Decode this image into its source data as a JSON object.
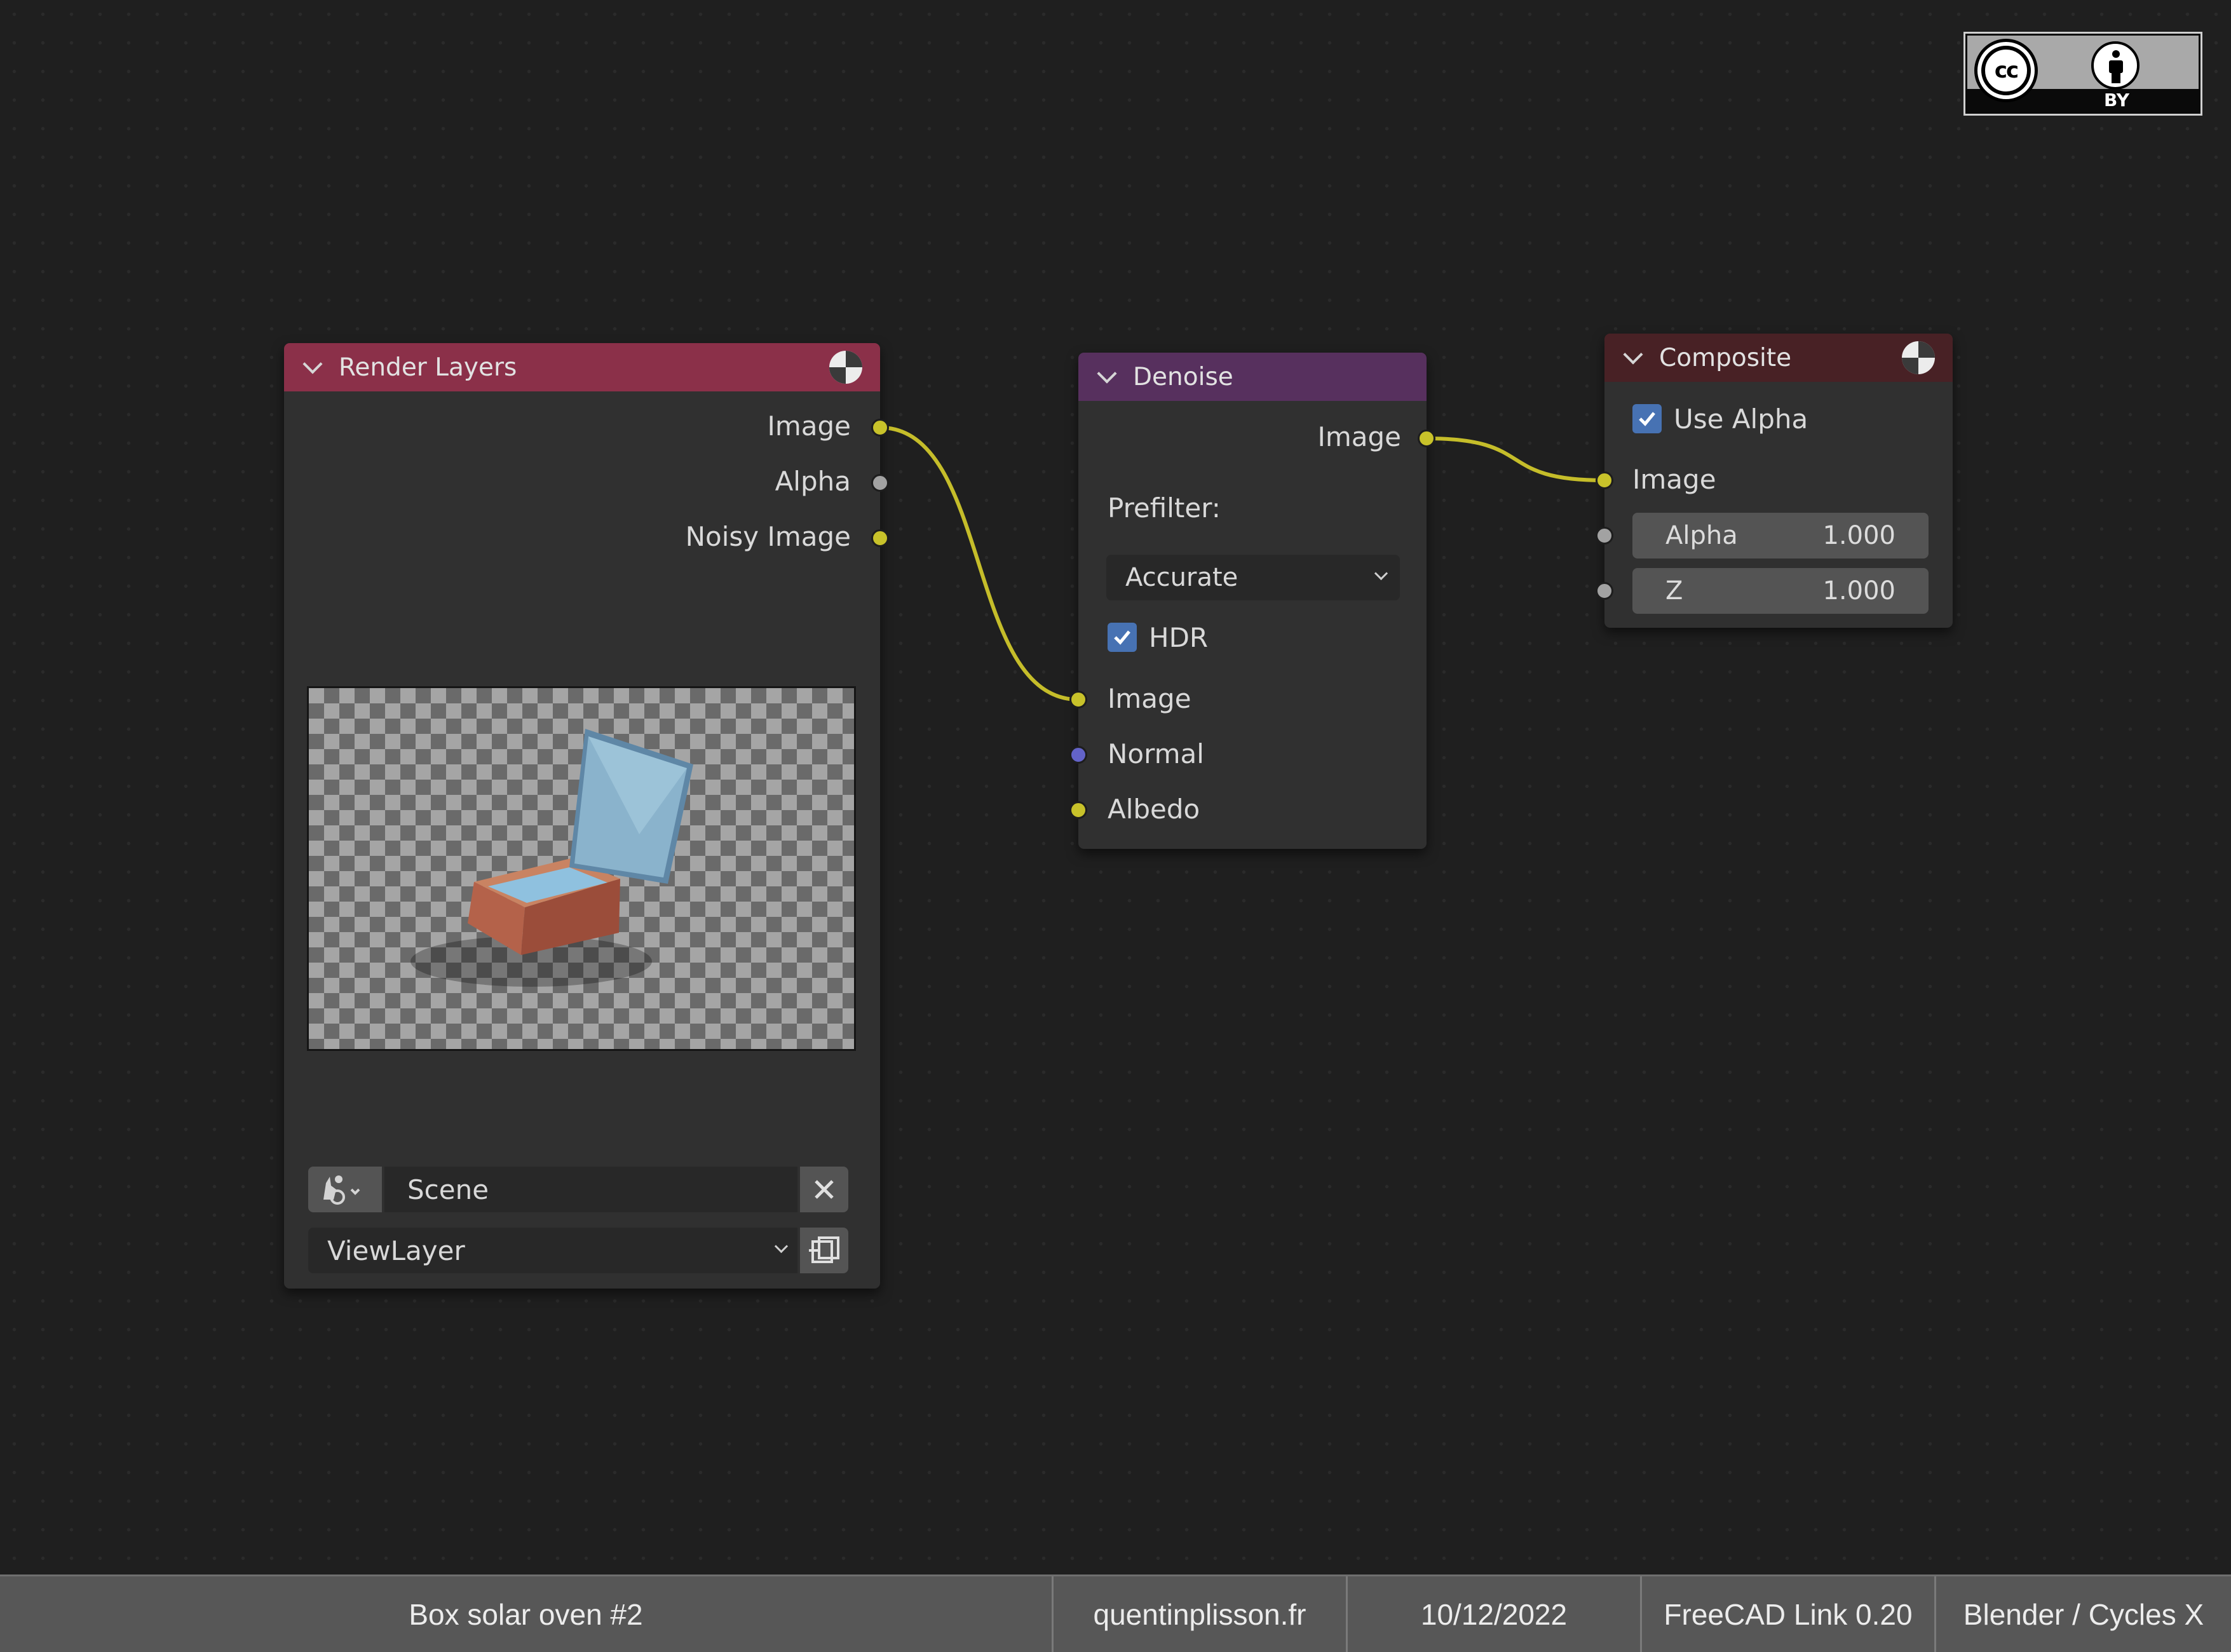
{
  "nodes": {
    "render_layers": {
      "title": "Render Layers",
      "outputs": [
        "Image",
        "Alpha",
        "Noisy Image"
      ],
      "scene": "Scene",
      "view_layer": "ViewLayer"
    },
    "denoise": {
      "title": "Denoise",
      "output": "Image",
      "prefilter_label": "Prefilter:",
      "prefilter_value": "Accurate",
      "hdr_label": "HDR",
      "hdr_checked": true,
      "inputs": [
        "Image",
        "Normal",
        "Albedo"
      ]
    },
    "composite": {
      "title": "Composite",
      "use_alpha_label": "Use Alpha",
      "use_alpha_checked": true,
      "input_image": "Image",
      "alpha_label": "Alpha",
      "alpha_value": "1.000",
      "z_label": "Z",
      "z_value": "1.000"
    }
  },
  "badge": {
    "cc": "cc",
    "by": "BY"
  },
  "footer": {
    "title": "Box solar oven #2",
    "website": "quentinplisson.fr",
    "date": "10/12/2022",
    "tool": "FreeCAD Link 0.20",
    "engine": "Blender / Cycles X"
  },
  "colors": {
    "render_layers_header": "#8b3049",
    "denoise_header": "#57305e",
    "composite_header": "#482125",
    "link": "#c5bd2a",
    "socket_yellow": "#c8c22a",
    "socket_gray": "#a2a2a2",
    "socket_blue": "#6363c8",
    "checkbox": "#4772b3"
  }
}
